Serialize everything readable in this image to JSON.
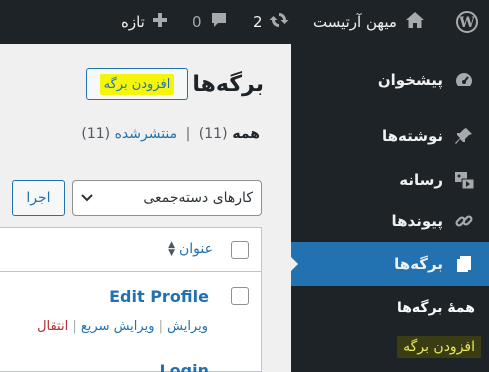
{
  "admin_bar": {
    "site_name": "میهن آرتیست",
    "updates_count": "2",
    "comments_count": "0",
    "new_label": "تازه"
  },
  "sidebar": {
    "items": [
      {
        "label": "پیشخوان",
        "icon": "dashboard-icon"
      },
      {
        "label": "نوشته‌ها",
        "icon": "pin-icon"
      },
      {
        "label": "رسانه",
        "icon": "media-icon"
      },
      {
        "label": "پیوندها",
        "icon": "link-icon"
      },
      {
        "label": "برگه‌ها",
        "icon": "pages-icon",
        "current": true
      }
    ],
    "submenu": [
      {
        "label": "همهٔ برگه‌ها"
      },
      {
        "label": "افزودن برگه"
      }
    ]
  },
  "content": {
    "title": "برگه‌ها",
    "add_new": "افزودن برگه",
    "views": {
      "all_label": "همه",
      "all_count": "(11)",
      "separator": "|",
      "published_label": "منتشرشده",
      "published_count": "(11)"
    },
    "bulk_actions": {
      "selected": "کارهای دسته‌جمعی",
      "apply": "اجرا"
    },
    "table": {
      "column_title": "عنوان",
      "rows": [
        {
          "title": "Edit Profile",
          "actions": [
            "ویرایش",
            "ویرایش سریع",
            "انتقال"
          ]
        },
        {
          "title": "Login"
        }
      ]
    }
  },
  "colors": {
    "admin_dark": "#1d2327",
    "accent": "#2271b1",
    "highlight": "#f5f50a",
    "trash": "#b32d2e"
  }
}
